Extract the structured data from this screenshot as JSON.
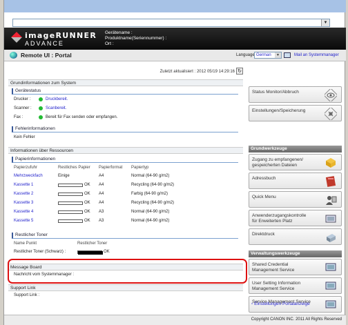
{
  "header": {
    "logo_line1": "imageRUNNER",
    "logo_line2": "ADVANCE",
    "device_name": "Gerätename :",
    "product_name": "Produktname(Seriennummer) :",
    "location": "Ort :"
  },
  "portal": {
    "title": "Remote UI : Portal",
    "language_label": "Language:",
    "language_value": "German",
    "mail_link": "Mail an Systemmanager"
  },
  "main": {
    "last_updated": "Zuletzt aktualisiert : 2012 05/19 14:29:16",
    "sys_info_title": "Grundinformationen zum System",
    "device_status_title": "Gerätestatus",
    "status_rows": [
      {
        "label": "Drucker :",
        "value": "Druckbereit."
      },
      {
        "label": "Scanner :",
        "value": "Scanbereit."
      },
      {
        "label": "Fax :",
        "value": "Bereit für Fax senden oder empfangen."
      }
    ],
    "error_title": "Fehlerinformationen",
    "error_value": "Kein Fehler",
    "resource_title": "Informationen über Ressourcen",
    "paper_title": "Papierinformationen",
    "paper_headers": [
      "Papierzufuhr",
      "Restliches Papier",
      "Papierformat",
      "Papiertyp"
    ],
    "paper_rows": [
      {
        "source": "Mehrzweckfach",
        "remaining": "Einige",
        "size": "A4",
        "type": "Normal (64-90 g/m2)",
        "level": null
      },
      {
        "source": "Kassette 1",
        "remaining": "OK",
        "size": "A4",
        "type": "Recycling (64-90 g/m2)",
        "level": 0
      },
      {
        "source": "Kassette 2",
        "remaining": "OK",
        "size": "A4",
        "type": "Farbig (64-90 g/m2)",
        "level": 0
      },
      {
        "source": "Kassette 3",
        "remaining": "OK",
        "size": "A4",
        "type": "Recycling (64-90 g/m2)",
        "level": 0
      },
      {
        "source": "Kassette 4",
        "remaining": "OK",
        "size": "A3",
        "type": "Normal (64-90 g/m2)",
        "level": 0
      },
      {
        "source": "Kassette 5",
        "remaining": "OK",
        "size": "A3",
        "type": "Normal (64-90 g/m2)",
        "level": 0
      }
    ],
    "toner_title": "Restlicher Toner",
    "toner_headers": [
      "Name Punkt",
      "Restlicher Toner"
    ],
    "toner_row": {
      "name": "Restlicher Toner (Schwarz) :",
      "status": "OK",
      "level": 1
    },
    "message_title": "Message Board",
    "message_text": "Nachricht vom Systemmanager :",
    "support_title": "Support Link",
    "support_text": "Support Link :"
  },
  "side": {
    "top_buttons": [
      {
        "label": "Status Monitor/Abbruch",
        "icon": "eye-icon"
      },
      {
        "label": "Einstellungen/Speicherung",
        "icon": "settings-icon"
      }
    ],
    "basic_title": "Grundwerkzeuge",
    "basic_buttons": [
      {
        "label": "Zugang zu empfangenen/ gespeicherten Dateien",
        "icon": "folder-icon"
      },
      {
        "label": "Adressbuch",
        "icon": "addressbook-icon"
      },
      {
        "label": "Quick Menu",
        "icon": "quickmenu-icon"
      },
      {
        "label": "Anwenderzugangskontrolle für Erweiterten Platz",
        "icon": "access-icon"
      },
      {
        "label": "Direktdruck",
        "icon": "printer-icon"
      }
    ],
    "mgmt_title": "Verwaltungswerkzeuge",
    "mgmt_buttons": [
      {
        "label": "Shared Credential Management Service",
        "icon": "monitor-icon"
      },
      {
        "label": "User Setting Information Management Service",
        "icon": "monitor-icon"
      },
      {
        "label": "Service Management Service",
        "icon": "monitor-icon"
      }
    ],
    "portal_settings": "Einstellungen Portalanzeige"
  },
  "footer": {
    "copyright": "Copyright CANON INC. 2011 All Rights Reserved"
  },
  "colors": {
    "highlight": "#dd1111",
    "status_green": "#22bb33",
    "link": "#2222cc"
  }
}
